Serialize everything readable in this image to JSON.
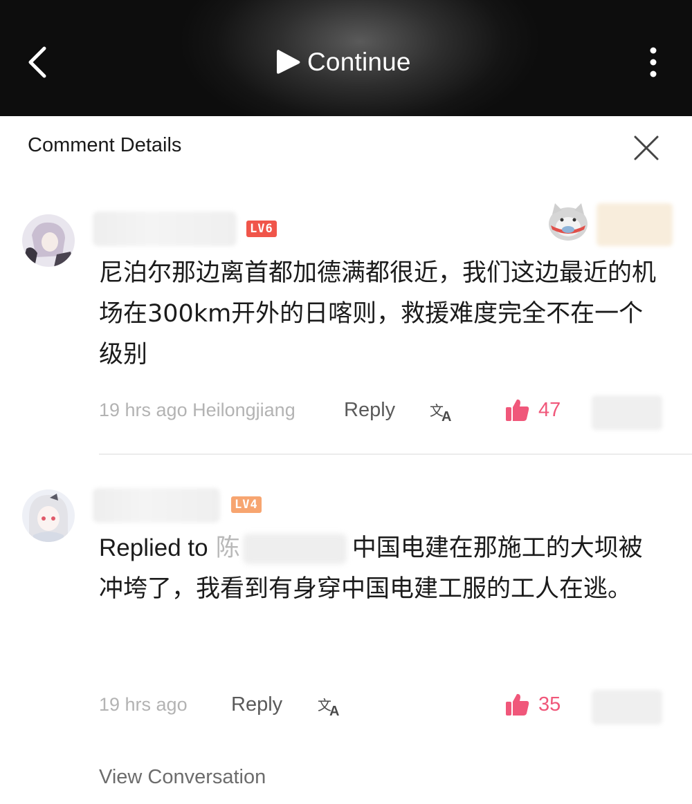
{
  "header": {
    "continue_label": "Continue",
    "icons": {
      "back": "chevron-left-icon",
      "play": "play-icon",
      "more": "more-vertical-icon"
    }
  },
  "sheet": {
    "title": "Comment Details",
    "close_icon": "close-icon"
  },
  "comments": [
    {
      "level": "LV6",
      "level_color": "#f0554a",
      "content": "尼泊尔那边离首都加德满都很近，我们这边最近的机场在300km开外的日喀则，救援难度完全不在一个级别",
      "time": "19 hrs ago",
      "location": "Heilongjiang",
      "reply_label": "Reply",
      "likes": "47"
    },
    {
      "level": "LV4",
      "level_color": "#f7a570",
      "replied_prefix": "Replied to",
      "replied_name_visible": "陈",
      "content": "中国电建在那施工的大坝被冲垮了，我看到有身穿中国电建工服的工人在逃。",
      "time": "19 hrs ago",
      "reply_label": "Reply",
      "likes": "35"
    }
  ],
  "view_conversation": "View Conversation",
  "colors": {
    "like": "#f0577a",
    "meta": "#b3b3b3",
    "accent_lv6": "#f0554a",
    "accent_lv4": "#f7a570"
  }
}
